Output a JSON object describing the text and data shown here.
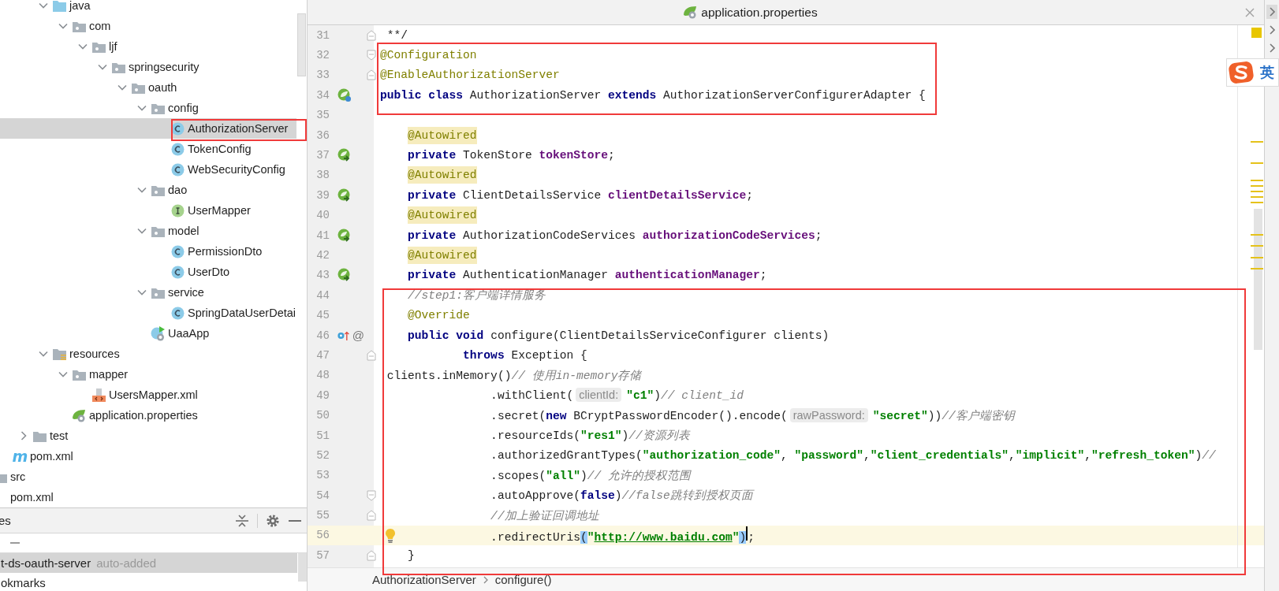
{
  "tree": [
    {
      "children": [
        {
          "children": [
            {
              "children": [
                {
                  "label": "java",
                  "kind": "source-root",
                  "expanded": true,
                  "selected": false,
                  "children": [
                    {
                      "label": "com",
                      "kind": "package",
                      "expanded": true,
                      "selected": false,
                      "children": [
                        {
                          "label": "ljf",
                          "kind": "package",
                          "expanded": true,
                          "selected": false,
                          "children": [
                            {
                              "label": "springsecurity",
                              "kind": "package",
                              "expanded": true,
                              "selected": false,
                              "children": [
                                {
                                  "label": "oauth",
                                  "kind": "package",
                                  "expanded": true,
                                  "selected": false,
                                  "children": [
                                    {
                                      "label": "config",
                                      "kind": "package",
                                      "expanded": true,
                                      "selected": false,
                                      "children": [
                                        {
                                          "label": "AuthorizationServer",
                                          "kind": "class",
                                          "selected": true
                                        },
                                        {
                                          "label": "TokenConfig",
                                          "kind": "class",
                                          "selected": false
                                        },
                                        {
                                          "label": "WebSecurityConfig",
                                          "kind": "class",
                                          "selected": false
                                        }
                                      ]
                                    },
                                    {
                                      "label": "dao",
                                      "kind": "package",
                                      "expanded": true,
                                      "selected": false,
                                      "children": [
                                        {
                                          "label": "UserMapper",
                                          "kind": "interface",
                                          "selected": false
                                        }
                                      ]
                                    },
                                    {
                                      "label": "model",
                                      "kind": "package",
                                      "expanded": true,
                                      "selected": false,
                                      "children": [
                                        {
                                          "label": "PermissionDto",
                                          "kind": "class",
                                          "selected": false
                                        },
                                        {
                                          "label": "UserDto",
                                          "kind": "class",
                                          "selected": false
                                        }
                                      ]
                                    },
                                    {
                                      "label": "service",
                                      "kind": "package",
                                      "expanded": true,
                                      "selected": false,
                                      "children": [
                                        {
                                          "label": "SpringDataUserDetai",
                                          "kind": "class",
                                          "selected": false
                                        }
                                      ]
                                    },
                                    {
                                      "label": "UaaApp",
                                      "kind": "spring-boot-class",
                                      "selected": false
                                    }
                                  ]
                                }
                              ]
                            }
                          ]
                        }
                      ]
                    }
                  ]
                },
                {
                  "label": "resources",
                  "kind": "resources-root",
                  "expanded": true,
                  "selected": false,
                  "children": [
                    {
                      "label": "mapper",
                      "kind": "package",
                      "expanded": true,
                      "selected": false,
                      "children": [
                        {
                          "label": "UsersMapper.xml",
                          "kind": "xml-file",
                          "selected": false
                        }
                      ]
                    },
                    {
                      "label": "application.properties",
                      "kind": "properties-file",
                      "selected": false
                    }
                  ]
                }
              ]
            },
            {
              "label": "test",
              "kind": "folder",
              "expanded": false,
              "selected": false
            }
          ]
        },
        {
          "label": "pom.xml",
          "kind": "maven-file",
          "badge": "m",
          "selected": false
        }
      ]
    },
    {
      "label": "src",
      "kind": "folder",
      "selected": false
    },
    {
      "label": "pom.xml",
      "kind": "maven-file",
      "selected": false
    }
  ],
  "bottom_panel": {
    "title": "es",
    "items": [
      {
        "label": "t-ds-oauth-server",
        "note": "auto-added",
        "selected": true
      },
      {
        "label": "okmarks",
        "selected": false
      }
    ]
  },
  "editor": {
    "tab": {
      "label": "application.properties"
    },
    "lines": [
      {
        "n": "31",
        "current": false,
        "fold": {
          "kind": "end"
        },
        "tokens": [
          {
            "kind": "plain",
            "text": " **/"
          }
        ]
      },
      {
        "n": "32",
        "current": false,
        "fold": {
          "kind": "start"
        },
        "tokens": [
          {
            "kind": "annotation",
            "text": "@Configuration"
          }
        ]
      },
      {
        "n": "33",
        "current": false,
        "fold": {
          "kind": "end"
        },
        "tokens": [
          {
            "kind": "annotation",
            "text": "@EnableAuthorizationServer"
          }
        ]
      },
      {
        "n": "34",
        "current": false,
        "gutter": [
          {
            "kind": "bean"
          }
        ],
        "tokens": [
          {
            "kind": "keyword",
            "text": "public class"
          },
          {
            "kind": "plain",
            "text": " AuthorizationServer "
          },
          {
            "kind": "keyword",
            "text": "extends"
          },
          {
            "kind": "plain",
            "text": " AuthorizationServerConfigurerAdapter {"
          }
        ]
      },
      {
        "n": "35",
        "current": false
      },
      {
        "n": "36",
        "current": false,
        "block": {
          "kind": "member"
        },
        "tokens": [
          {
            "kind": "annotation-marked",
            "text": "@Autowired"
          }
        ]
      },
      {
        "n": "37",
        "current": false,
        "gutter": [
          {
            "kind": "autowired"
          }
        ],
        "tokens": [
          {
            "kind": "keyword",
            "text": "    private"
          },
          {
            "kind": "plain",
            "text": " TokenStore "
          },
          {
            "kind": "field",
            "text": "tokenStore"
          },
          {
            "kind": "plain",
            "text": ";"
          }
        ]
      },
      {
        "n": "38",
        "current": false,
        "block": {
          "kind": "member"
        },
        "tokens": [
          {
            "kind": "annotation-marked",
            "text": "@Autowired"
          }
        ]
      },
      {
        "n": "39",
        "current": false,
        "gutter": [
          {
            "kind": "autowired"
          }
        ],
        "tokens": [
          {
            "kind": "keyword",
            "text": "    private"
          },
          {
            "kind": "plain",
            "text": " ClientDetailsService "
          },
          {
            "kind": "field",
            "text": "clientDetailsService"
          },
          {
            "kind": "plain",
            "text": ";"
          }
        ]
      },
      {
        "n": "40",
        "current": false,
        "block": {
          "kind": "member"
        },
        "tokens": [
          {
            "kind": "annotation-marked",
            "text": "@Autowired"
          }
        ]
      },
      {
        "n": "41",
        "current": false,
        "gutter": [
          {
            "kind": "autowired"
          }
        ],
        "tokens": [
          {
            "kind": "keyword",
            "text": "    private"
          },
          {
            "kind": "plain",
            "text": " AuthorizationCodeServices "
          },
          {
            "kind": "field",
            "text": "authorizationCodeServices"
          },
          {
            "kind": "plain",
            "text": ";"
          }
        ]
      },
      {
        "n": "42",
        "current": false,
        "block": {
          "kind": "member"
        },
        "tokens": [
          {
            "kind": "annotation-marked",
            "text": "@Autowired"
          }
        ]
      },
      {
        "n": "43",
        "current": false,
        "gutter": [
          {
            "kind": "autowired"
          }
        ],
        "tokens": [
          {
            "kind": "keyword",
            "text": "    private"
          },
          {
            "kind": "plain",
            "text": " AuthenticationManager "
          },
          {
            "kind": "field",
            "text": "authenticationManager"
          },
          {
            "kind": "plain",
            "text": ";"
          }
        ]
      },
      {
        "n": "44",
        "current": false,
        "tokens": [
          {
            "kind": "comment",
            "text": "    //step1:客户端详情服务"
          }
        ]
      },
      {
        "n": "45",
        "current": false,
        "tokens": [
          {
            "kind": "annotation",
            "text": "    @Override"
          }
        ]
      },
      {
        "n": "46",
        "current": false,
        "gutter": [
          {
            "kind": "override"
          },
          {
            "kind": "symbol",
            "text": "@"
          }
        ],
        "tokens": [
          {
            "kind": "keyword",
            "text": "    public void"
          },
          {
            "kind": "plain",
            "text": " configure(ClientDetailsServiceConfigurer clients)"
          }
        ]
      },
      {
        "n": "47",
        "current": false,
        "fold": {
          "kind": "end"
        },
        "tokens": [
          {
            "kind": "keyword",
            "text": "            throws"
          },
          {
            "kind": "plain",
            "text": " Exception {"
          }
        ]
      },
      {
        "n": "48",
        "current": false,
        "tokens": [
          {
            "kind": "plain",
            "text": " clients.inMemory()"
          },
          {
            "kind": "comment",
            "text": "// 使用in-memory存储"
          }
        ]
      },
      {
        "n": "49",
        "current": false,
        "tokens": [
          {
            "kind": "plain",
            "text": "                .withClient("
          },
          {
            "kind": "hint",
            "text": "clientId:"
          },
          {
            "kind": "string",
            "text": "\"c1\""
          },
          {
            "kind": "plain",
            "text": ")"
          },
          {
            "kind": "comment",
            "text": "// client_id"
          }
        ]
      },
      {
        "n": "50",
        "current": false,
        "tokens": [
          {
            "kind": "plain",
            "text": "                .secret("
          },
          {
            "kind": "keyword",
            "text": "new"
          },
          {
            "kind": "plain",
            "text": " BCryptPasswordEncoder().encode("
          },
          {
            "kind": "hint",
            "text": "rawPassword:"
          },
          {
            "kind": "string",
            "text": "\"secret\""
          },
          {
            "kind": "plain",
            "text": "))"
          },
          {
            "kind": "comment",
            "text": "//客户端密钥"
          }
        ]
      },
      {
        "n": "51",
        "current": false,
        "tokens": [
          {
            "kind": "plain",
            "text": "                .resourceIds("
          },
          {
            "kind": "string",
            "text": "\"res1\""
          },
          {
            "kind": "plain",
            "text": ")"
          },
          {
            "kind": "comment",
            "text": "//资源列表"
          }
        ]
      },
      {
        "n": "52",
        "current": false,
        "tokens": [
          {
            "kind": "plain",
            "text": "                .authorizedGrantTypes("
          },
          {
            "kind": "string",
            "text": "\"authorization_code\""
          },
          {
            "kind": "plain",
            "text": ", "
          },
          {
            "kind": "string",
            "text": "\"password\""
          },
          {
            "kind": "plain",
            "text": ","
          },
          {
            "kind": "string",
            "text": "\"client_credentials\""
          },
          {
            "kind": "plain",
            "text": ","
          },
          {
            "kind": "string",
            "text": "\"implicit\""
          },
          {
            "kind": "plain",
            "text": ","
          },
          {
            "kind": "string",
            "text": "\"refresh_token\""
          },
          {
            "kind": "plain",
            "text": ")"
          },
          {
            "kind": "comment",
            "text": "//"
          }
        ]
      },
      {
        "n": "53",
        "current": false,
        "tokens": [
          {
            "kind": "plain",
            "text": "                .scopes("
          },
          {
            "kind": "string",
            "text": "\"all\""
          },
          {
            "kind": "plain",
            "text": ")"
          },
          {
            "kind": "comment",
            "text": "// 允许的授权范围"
          }
        ]
      },
      {
        "n": "54",
        "current": false,
        "fold": {
          "kind": "start"
        },
        "tokens": [
          {
            "kind": "plain",
            "text": "                .autoApprove("
          },
          {
            "kind": "keyword",
            "text": "false"
          },
          {
            "kind": "plain",
            "text": ")"
          },
          {
            "kind": "comment",
            "text": "//false跳转到授权页面"
          }
        ]
      },
      {
        "n": "55",
        "current": false,
        "fold": {
          "kind": "end"
        },
        "tokens": [
          {
            "kind": "comment",
            "text": "                //加上验证回调地址"
          }
        ]
      },
      {
        "n": "56",
        "current": true,
        "gutter": [
          {
            "kind": "bulb"
          }
        ],
        "tokens": [
          {
            "kind": "plain",
            "text": "                .redirectUris"
          },
          {
            "kind": "brace",
            "text": "("
          },
          {
            "kind": "string",
            "text": "\""
          },
          {
            "kind": "link",
            "text": "http://www.baidu.com"
          },
          {
            "kind": "string",
            "text": "\""
          },
          {
            "kind": "brace",
            "text": ")"
          },
          {
            "kind": "caret"
          },
          {
            "kind": "plain",
            "text": ";"
          }
        ]
      },
      {
        "n": "57",
        "current": false,
        "fold": {
          "kind": "end"
        },
        "tokens": [
          {
            "kind": "plain",
            "text": "    }"
          }
        ]
      }
    ],
    "breadcrumbs": [
      "AuthorizationServer",
      "configure()"
    ]
  },
  "ime": {
    "mode": "英"
  }
}
